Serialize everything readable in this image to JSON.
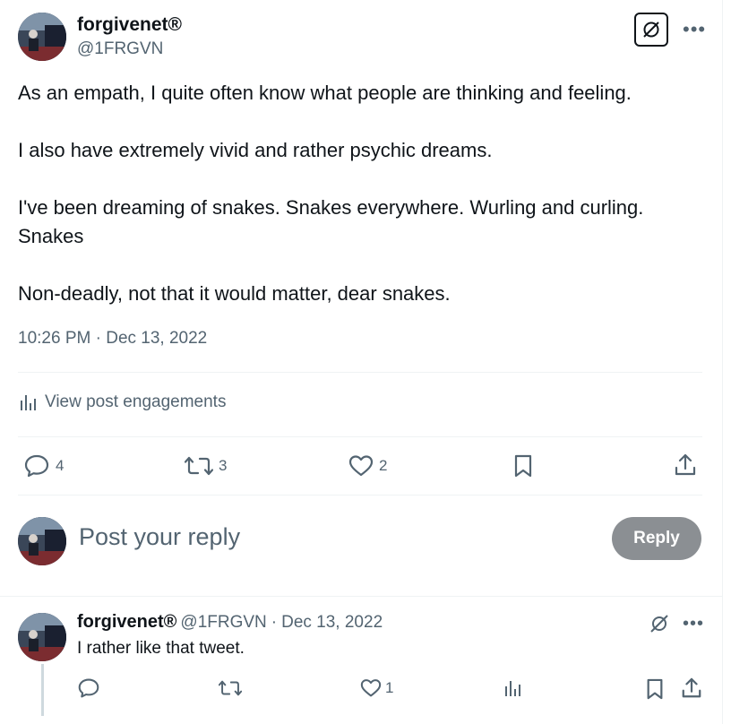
{
  "post": {
    "display_name": "forgivenet®",
    "handle": "@1FRGVN",
    "paragraphs": [
      "As an empath, I quite often know what people are thinking and feeling.",
      "I also have extremely vivid and rather psychic dreams.",
      "I've been dreaming of snakes. Snakes everywhere. Wurling and curling.\nSnakes",
      "Non-deadly, not that it would matter, dear snakes."
    ],
    "time": "10:26 PM",
    "separator": "·",
    "date": "Dec 13, 2022",
    "engagements_label": "View post engagements",
    "stats": {
      "replies": "4",
      "reposts": "3",
      "likes": "2"
    }
  },
  "composer": {
    "placeholder": "Post your reply",
    "reply_button": "Reply"
  },
  "reply": {
    "display_name": "forgivenet®",
    "handle": "@1FRGVN",
    "separator": "·",
    "date": "Dec 13, 2022",
    "text": "I rather like that tweet.",
    "stats": {
      "likes": "1"
    }
  },
  "icons": {
    "grok": "grok-icon",
    "more": "more-icon",
    "engagements": "bar-chart-icon",
    "reply": "speech-bubble-icon",
    "repost": "repost-icon",
    "like": "heart-icon",
    "bookmark": "bookmark-icon",
    "share": "share-icon",
    "views": "views-icon"
  },
  "colors": {
    "text": "#0f1419",
    "secondary": "#536471",
    "divider": "#eff3f4",
    "reply_button_bg": "#8b8f93"
  }
}
